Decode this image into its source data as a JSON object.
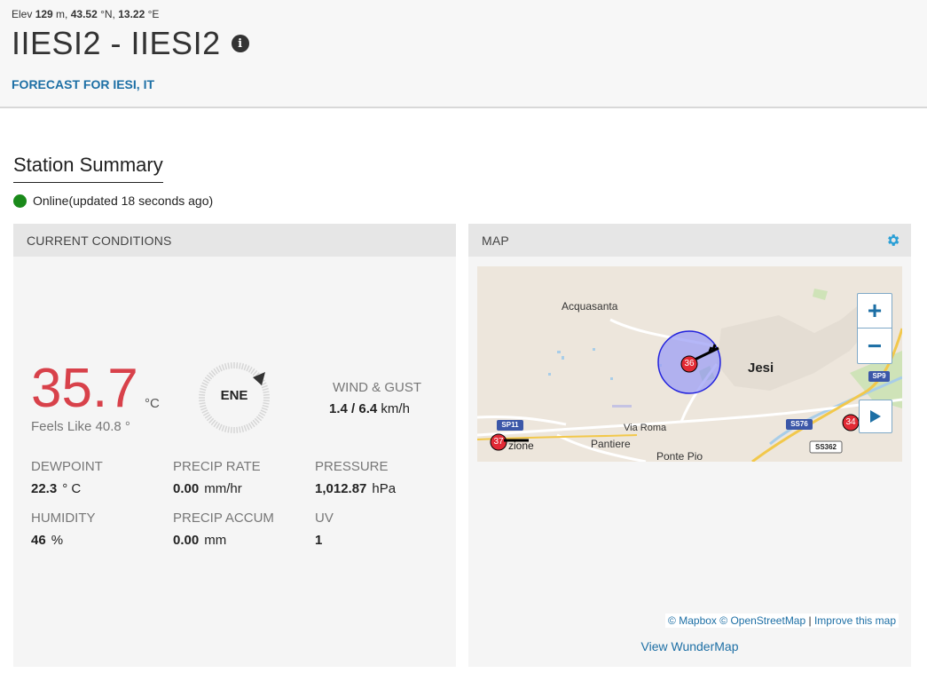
{
  "header": {
    "elev_prefix": "Elev ",
    "elev_value": "129",
    "elev_unit": " m, ",
    "lat_value": "43.52",
    "lat_unit": " °N, ",
    "lon_value": "13.22",
    "lon_unit": " °E",
    "title": "IIESI2 - IIESI2",
    "info_glyph": "i",
    "forecast_link": "FORECAST FOR IESI, IT"
  },
  "summary": {
    "title": "Station Summary",
    "status": "Online(updated 18 seconds ago)",
    "status_color": "#1a8a1a"
  },
  "current": {
    "heading": "CURRENT CONDITIONS",
    "temperature": "35.7",
    "temp_unit": "°C",
    "feels_like": "Feels Like 40.8 °",
    "wind_dir": "ENE",
    "wind_label": "WIND & GUST",
    "wind_speed": "1.4",
    "wind_sep": " / ",
    "wind_gust": "6.4",
    "wind_unit": " km/h",
    "metrics": [
      {
        "label": "DEWPOINT",
        "value": "22.3",
        "unit": "° C"
      },
      {
        "label": "PRECIP RATE",
        "value": "0.00",
        "unit": "mm/hr"
      },
      {
        "label": "PRESSURE",
        "value": "1,012.87",
        "unit": "hPa"
      },
      {
        "label": "HUMIDITY",
        "value": "46",
        "unit": "%"
      },
      {
        "label": "PRECIP ACCUM",
        "value": "0.00",
        "unit": "mm"
      },
      {
        "label": "UV",
        "value": "1",
        "unit": ""
      }
    ],
    "temp_color": "#d8414a"
  },
  "map": {
    "heading": "MAP",
    "places": {
      "acquasanta": "Acquasanta",
      "jesi": "Jesi",
      "pantiere": "Pantiere",
      "via_roma": "Via Roma",
      "ponte_pio": "Ponte Pio",
      "zione": "zione"
    },
    "road_labels": {
      "sp9": "SP9",
      "sp11": "SP11",
      "ss76": "SS76",
      "ss362": "SS362"
    },
    "markers": [
      {
        "label": "36"
      },
      {
        "label": "37"
      },
      {
        "label": "34"
      }
    ],
    "zoom_in": "+",
    "zoom_out": "−",
    "attrib_mapbox": "© Mapbox",
    "attrib_osm": "© OpenStreetMap",
    "attrib_sep": " | ",
    "attrib_improve": "Improve this map",
    "view_link": "View WunderMap"
  }
}
